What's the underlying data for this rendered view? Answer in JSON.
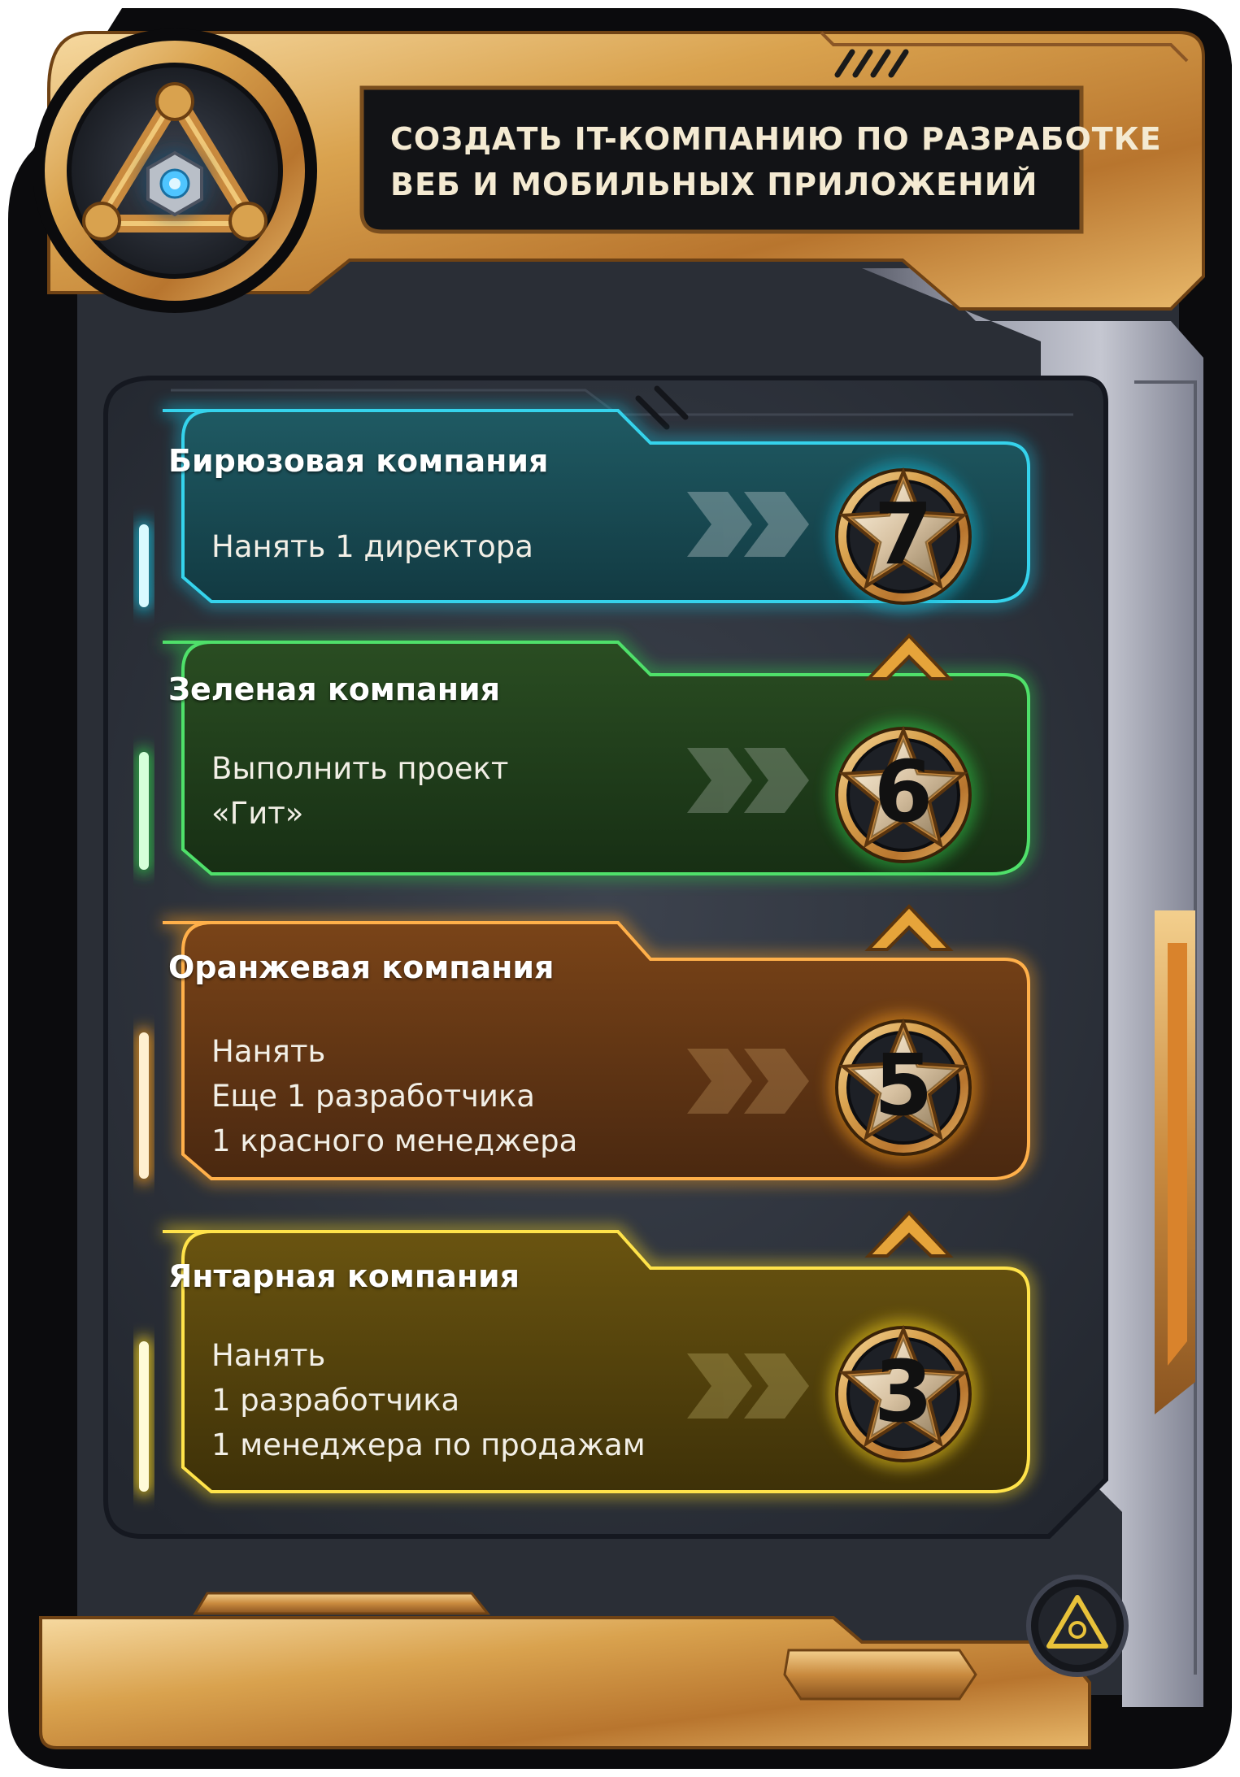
{
  "header": {
    "title_lines": [
      "СОЗДАТЬ IT-КОМПАНИЮ ПО РАЗРАБОТКЕ",
      "ВЕБ И МОБИЛЬНЫХ ПРИЛОЖЕНИЙ"
    ]
  },
  "companies": [
    {
      "name": "Бирюзовая компания",
      "tasks": [
        "Нанять 1 директора"
      ],
      "stars": "7",
      "color": "#19b6d2"
    },
    {
      "name": "Зеленая компания",
      "tasks": [
        "Выполнить проект",
        "«Гит»"
      ],
      "stars": "6",
      "color": "#2ec24a"
    },
    {
      "name": "Оранжевая компания",
      "tasks": [
        "Нанять",
        "Еще 1 разработчика",
        "1 красного менеджера"
      ],
      "stars": "5",
      "color": "#f39a1c"
    },
    {
      "name": "Янтарная компания",
      "tasks": [
        "Нанять",
        "1 разработчика",
        "1 менеджера по продажам"
      ],
      "stars": "3",
      "color": "#f5d21e"
    }
  ],
  "icons": {
    "emblem": "triangle-core-emblem-icon",
    "corner": "small-emblem-icon",
    "badge": "star-badge-icon",
    "arrow": "chevron-up-icon",
    "progress": "double-chevron-right-icon"
  },
  "colors": {
    "gold": "#d9a24e",
    "frame_dark": "#1b1f26",
    "metal": "#8f92a0"
  }
}
